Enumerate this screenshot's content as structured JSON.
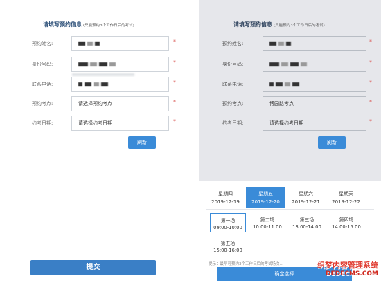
{
  "form": {
    "title": "请填写预约信息",
    "hint": "(只能预约3个工作日后的考试)",
    "fields": [
      {
        "label": "预约姓名:",
        "value": "",
        "required": "*"
      },
      {
        "label": "身份号码:",
        "value": "",
        "required": "*"
      },
      {
        "label": "联系电话:",
        "value": "",
        "required": "*"
      },
      {
        "label": "预约考点:",
        "value": "请选择预约考点",
        "required": "*"
      },
      {
        "label": "约考日期:",
        "value": "请选择约考日期",
        "required": "*"
      }
    ],
    "refresh_label": "刷新",
    "submit_label": "提交"
  },
  "right_form": {
    "title": "请填写预约信息",
    "hint": "(只能预约3个工作日后的考试)",
    "fields": [
      {
        "label": "预约姓名:",
        "value": "",
        "required": "*"
      },
      {
        "label": "身份号码:",
        "value": "",
        "required": "*"
      },
      {
        "label": "联系电话:",
        "value": "",
        "required": "*"
      },
      {
        "label": "预约考点:",
        "value": "博园路考点",
        "required": "*"
      },
      {
        "label": "约考日期:",
        "value": "请选择约考日期",
        "required": "*"
      }
    ],
    "refresh_label": "刷新"
  },
  "picker": {
    "days": [
      {
        "weekday": "星期四",
        "date": "2019-12-19",
        "active": false
      },
      {
        "weekday": "星期五",
        "date": "2019-12-20",
        "active": true
      },
      {
        "weekday": "星期六",
        "date": "2019-12-21",
        "active": false
      },
      {
        "weekday": "星期天",
        "date": "2019-12-22",
        "active": false
      }
    ],
    "slots": [
      {
        "name": "第一场",
        "time": "09:00-10:00",
        "selected": true
      },
      {
        "name": "第二场",
        "time": "10:00-11:00",
        "selected": false
      },
      {
        "name": "第三场",
        "time": "13:00-14:00",
        "selected": false
      },
      {
        "name": "第四场",
        "time": "14:00-15:00",
        "selected": false
      },
      {
        "name": "第五场",
        "time": "15:00-16:00",
        "selected": false
      }
    ],
    "notice": "提示：最早可预约3个工作日后的考试场次…",
    "confirm_label": "确定选择"
  },
  "watermark": {
    "cn": "织梦内容管理系统",
    "en": "DEDECMS.COM"
  },
  "colors": {
    "accent": "#3a8bd8",
    "required": "#d9534f",
    "overlay": "#e6e7eb"
  }
}
